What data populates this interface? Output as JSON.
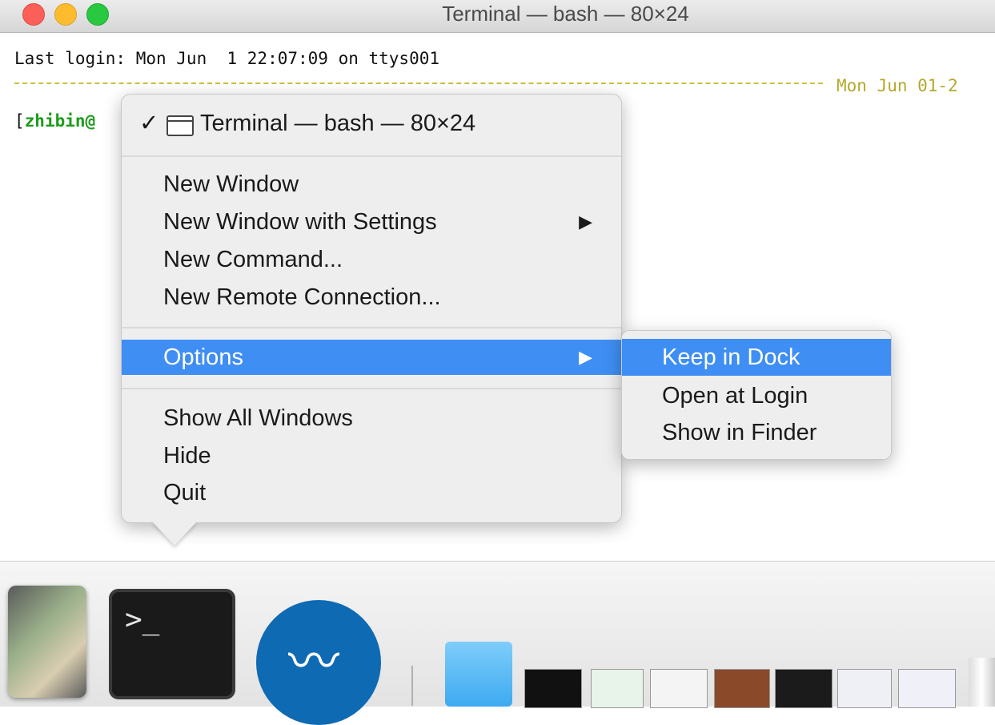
{
  "window": {
    "title": "Terminal — bash — 80×24"
  },
  "terminal": {
    "last_login": "Last login: Mon Jun  1 22:07:09 on ttys001",
    "date_right": "Mon Jun 01-2",
    "prompt_open": "[",
    "prompt_user": "zhibin@"
  },
  "context_menu": {
    "header": {
      "check": "✓",
      "label": "Terminal — bash — 80×24"
    },
    "items": [
      {
        "label": "New Window"
      },
      {
        "label": "New Window with Settings",
        "arrow": "▶"
      },
      {
        "label": "New Command..."
      },
      {
        "label": "New Remote Connection..."
      },
      {
        "label": "Options",
        "arrow": "▶"
      },
      {
        "label": "Show All Windows"
      },
      {
        "label": "Hide"
      },
      {
        "label": "Quit"
      }
    ]
  },
  "submenu": {
    "items": [
      {
        "label": "Keep in Dock"
      },
      {
        "label": "Open at Login"
      },
      {
        "label": "Show in Finder"
      }
    ]
  },
  "dock": {
    "terminal_glyph": ">_"
  },
  "colors": {
    "highlight": "#3f8ef3",
    "prompt_user": "#1c9c1c",
    "separator": "#b4a82c"
  }
}
